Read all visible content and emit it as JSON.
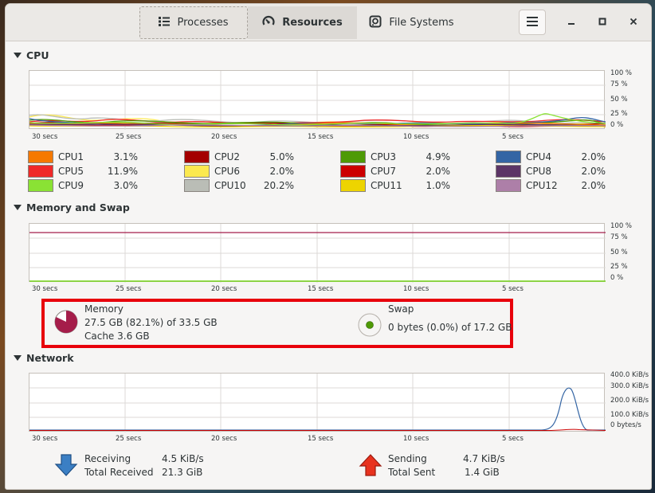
{
  "tabs": [
    {
      "label": "Processes",
      "icon": "list-icon"
    },
    {
      "label": "Resources",
      "icon": "gauge-icon"
    },
    {
      "label": "File Systems",
      "icon": "disk-icon"
    }
  ],
  "sections": {
    "cpu": "CPU",
    "memory": "Memory and Swap",
    "network": "Network"
  },
  "y_percent_labels": [
    "100 %",
    "75 %",
    "50 %",
    "25 %",
    "0 %"
  ],
  "y_network_labels": [
    "400.0 KiB/s",
    "300.0 KiB/s",
    "200.0 KiB/s",
    "100.0 KiB/s",
    "0 bytes/s"
  ],
  "x_labels": [
    "30 secs",
    "25 secs",
    "20 secs",
    "15 secs",
    "10 secs",
    "5 secs"
  ],
  "cpus": [
    {
      "name": "CPU1",
      "value": "3.1%",
      "color": "#f57900"
    },
    {
      "name": "CPU2",
      "value": "5.0%",
      "color": "#a40000"
    },
    {
      "name": "CPU3",
      "value": "4.9%",
      "color": "#4e9a06"
    },
    {
      "name": "CPU4",
      "value": "2.0%",
      "color": "#3465a4"
    },
    {
      "name": "CPU5",
      "value": "11.9%",
      "color": "#ef2929"
    },
    {
      "name": "CPU6",
      "value": "2.0%",
      "color": "#fce94f"
    },
    {
      "name": "CPU7",
      "value": "2.0%",
      "color": "#cc0000"
    },
    {
      "name": "CPU8",
      "value": "2.0%",
      "color": "#5c3566"
    },
    {
      "name": "CPU9",
      "value": "3.0%",
      "color": "#8ae234"
    },
    {
      "name": "CPU10",
      "value": "20.2%",
      "color": "#babdb6"
    },
    {
      "name": "CPU11",
      "value": "1.0%",
      "color": "#edd400"
    },
    {
      "name": "CPU12",
      "value": "2.0%",
      "color": "#ad7fa8"
    }
  ],
  "memory": {
    "title": "Memory",
    "usage": "27.5 GB (82.1%) of 33.5 GB",
    "cache": "Cache 3.6 GB",
    "fraction": 0.821,
    "color": "#a51d4a"
  },
  "swap": {
    "title": "Swap",
    "usage": "0 bytes (0.0%) of 17.2 GB",
    "fraction": 0.0,
    "color": "#4e9a06"
  },
  "network": {
    "receiving_label": "Receiving",
    "receiving_value": "4.5 KiB/s",
    "total_received_label": "Total Received",
    "total_received_value": "21.3 GiB",
    "sending_label": "Sending",
    "sending_value": "4.7 KiB/s",
    "total_sent_label": "Total Sent",
    "total_sent_value": "1.4 GiB"
  }
}
